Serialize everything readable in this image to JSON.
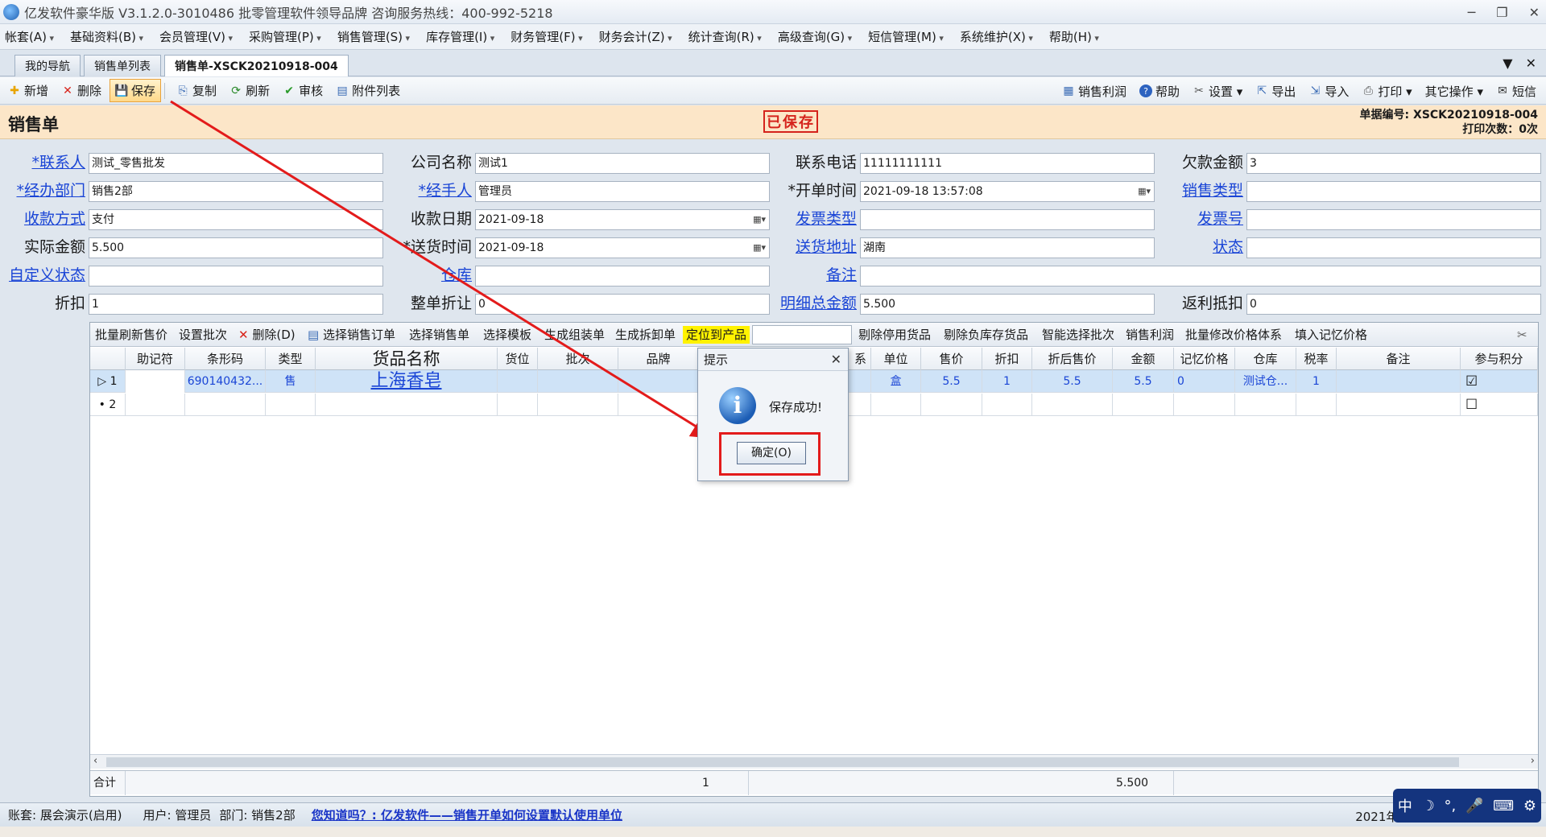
{
  "window": {
    "title": "亿发软件豪华版 V3.1.2.0-3010486 批零管理软件领导品牌 咨询服务热线：400-992-5218",
    "controls": [
      "─",
      "❐",
      "✕"
    ]
  },
  "menu": [
    "帐套(A)",
    "基础资料(B)",
    "会员管理(V)",
    "采购管理(P)",
    "销售管理(S)",
    "库存管理(I)",
    "财务管理(F)",
    "财务会计(Z)",
    "统计查询(R)",
    "高级查询(G)",
    "短信管理(M)",
    "系统维护(X)",
    "帮助(H)"
  ],
  "tabs": [
    "我的导航",
    "销售单列表",
    "销售单-XSCK20210918-004"
  ],
  "tab_tools": [
    "▼",
    "✕"
  ],
  "toolbar": {
    "left": [
      {
        "name": "new",
        "label": "新增",
        "icon": "✚",
        "color": "#e8a400"
      },
      {
        "name": "delete",
        "label": "删除",
        "icon": "✕",
        "color": "#d8231a"
      },
      {
        "name": "save",
        "label": "保存",
        "icon": "💾",
        "color": "#1f56b0"
      },
      {
        "name": "copy",
        "label": "复制",
        "icon": "⎘",
        "color": "#3a6bb5"
      },
      {
        "name": "refresh",
        "label": "刷新",
        "icon": "⟳",
        "color": "#2a8a2a"
      },
      {
        "name": "audit",
        "label": "审核",
        "icon": "✔",
        "color": "#2a9a2a"
      },
      {
        "name": "attachments",
        "label": "附件列表",
        "icon": "▤",
        "color": "#3a6bb5"
      }
    ],
    "right": [
      {
        "name": "sales-profit",
        "label": "销售利润",
        "icon": "▦"
      },
      {
        "name": "help",
        "label": "帮助",
        "icon": "?"
      },
      {
        "name": "settings",
        "label": "设置 ▾",
        "icon": "✂"
      },
      {
        "name": "export",
        "label": "导出",
        "icon": "⇱"
      },
      {
        "name": "import",
        "label": "导入",
        "icon": "⇲"
      },
      {
        "name": "print",
        "label": "打印 ▾",
        "icon": "⎙"
      },
      {
        "name": "other-ops",
        "label": "其它操作 ▾",
        "icon": ""
      },
      {
        "name": "sms",
        "label": "短信",
        "icon": "✉"
      }
    ]
  },
  "header": {
    "title": "销售单",
    "stamp": "已保存",
    "doc_no_label": "单据编号:",
    "doc_no": "XSCK20210918-004",
    "print_count": "打印次数：0次"
  },
  "form": {
    "contact": {
      "label": "*联系人",
      "value": "测试_零售批发"
    },
    "company": {
      "label": "公司名称",
      "value": "测试1"
    },
    "phone": {
      "label": "联系电话",
      "value": "11111111111"
    },
    "owed": {
      "label": "欠款金额",
      "value": "3"
    },
    "dept": {
      "label": "*经办部门",
      "value": "销售2部"
    },
    "handler": {
      "label": "*经手人",
      "value": "管理员"
    },
    "open_time": {
      "label": "*开单时间",
      "value": "2021-09-18 13:57:08"
    },
    "sale_type": {
      "label": "销售类型",
      "value": ""
    },
    "pay_method": {
      "label": "收款方式",
      "value": "支付"
    },
    "pay_date": {
      "label": "收款日期",
      "value": "2021-09-18"
    },
    "invoice_type": {
      "label": "发票类型",
      "value": ""
    },
    "invoice_no": {
      "label": "发票号",
      "value": ""
    },
    "actual_amount": {
      "label": "实际金额",
      "value": "5.500"
    },
    "delivery_time": {
      "label": "*送货时间",
      "value": "2021-09-18"
    },
    "delivery_addr": {
      "label": "送货地址",
      "value": "湖南"
    },
    "status": {
      "label": "状态",
      "value": ""
    },
    "custom_status": {
      "label": "自定义状态",
      "value": ""
    },
    "warehouse": {
      "label": "仓库",
      "value": ""
    },
    "remark": {
      "label": "备注",
      "value": ""
    },
    "discount": {
      "label": "折扣",
      "value": "1"
    },
    "order_discount": {
      "label": "整单折让",
      "value": "0"
    },
    "detail_total": {
      "label": "明细总金额",
      "value": "5.500"
    },
    "rebate": {
      "label": "返利抵扣",
      "value": "0"
    }
  },
  "grid_toolbar": [
    "批量刷新售价",
    "设置批次",
    "删除(D)",
    "选择销售订单",
    "选择销售单",
    "选择模板",
    "生成组装单",
    "生成拆卸单",
    "定位到产品",
    "剔除停用货品",
    "剔除负库存货品",
    "智能选择批次",
    "销售利润",
    "批量修改价格体系",
    "填入记忆价格"
  ],
  "grid": {
    "columns": [
      "",
      "助记符",
      "条形码",
      "类型",
      "货品名称",
      "货位",
      "批次",
      "品牌",
      "系",
      "单位",
      "售价",
      "折扣",
      "折后售价",
      "金额",
      "记忆价格",
      "仓库",
      "税率",
      "备注",
      "参与积分"
    ],
    "rows": [
      {
        "no": "1",
        "mnemonic": "",
        "barcode": "690140432...",
        "type": "售",
        "name": "上海香皂",
        "location": "",
        "batch": "",
        "brand": "",
        "series": "",
        "unit": "盒",
        "price": "5.5",
        "discount": "1",
        "disc_price": "5.5",
        "amount": "5.5",
        "memory_price": "0",
        "warehouse": "测试仓...",
        "tax": "1",
        "remark": "",
        "points": "☑"
      },
      {
        "no": "2",
        "mnemonic": "",
        "barcode": "",
        "type": "",
        "name": "",
        "location": "",
        "batch": "",
        "brand": "",
        "series": "",
        "unit": "",
        "price": "",
        "discount": "",
        "disc_price": "",
        "amount": "",
        "memory_price": "",
        "warehouse": "",
        "tax": "",
        "remark": "",
        "points": "☐"
      }
    ],
    "total_label": "合计",
    "total_qty": "1",
    "total_amount": "5.500"
  },
  "dialog": {
    "title": "提示",
    "message": "保存成功!",
    "ok": "确定(O)",
    "close": "✕"
  },
  "status": {
    "account": "账套: 展会演示(启用)",
    "user": "用户: 管理员",
    "dept": "部门: 销售2部",
    "tip": "您知道吗？: 亿发软件——销售开单如何设置默认使用单位",
    "date": "2021年9月18"
  },
  "ime": [
    "中",
    "☽",
    "°,",
    "🎤",
    "⌨",
    "⚙"
  ],
  "colors": {
    "annotation": "#e31b1b",
    "link": "#1a45d6",
    "header_bg": "#fce6c8"
  }
}
